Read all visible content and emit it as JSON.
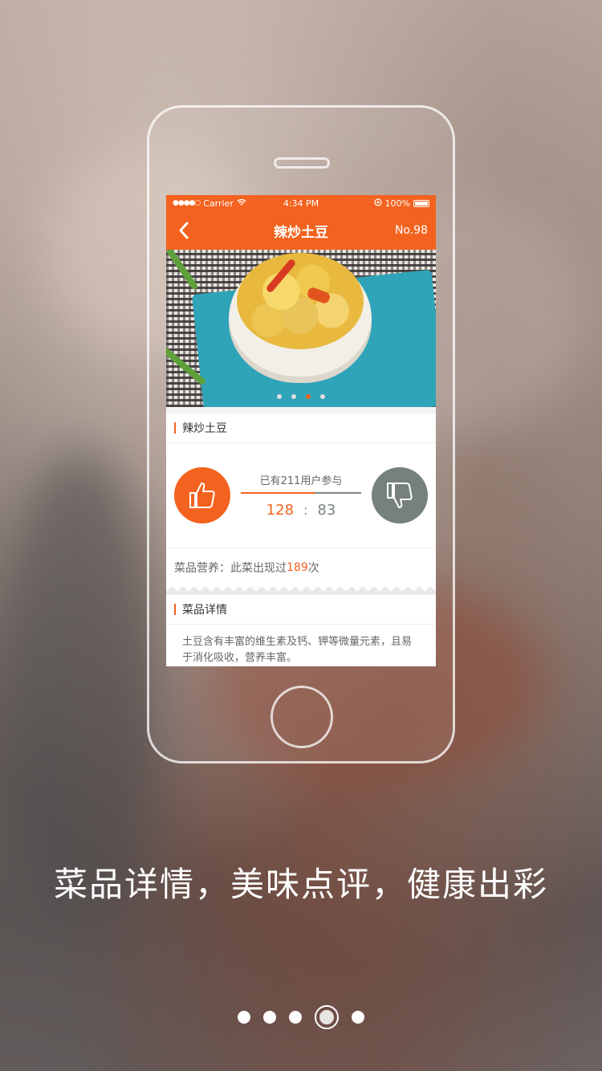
{
  "status_bar": {
    "carrier": "Carrier",
    "time": "4:34 PM",
    "battery": "100%"
  },
  "nav": {
    "title": "辣炒土豆",
    "number": "No.98"
  },
  "photo_pager": {
    "count": 4,
    "active_index": 2
  },
  "dish_section": {
    "title": "辣炒土豆"
  },
  "vote": {
    "participants": "已有211用户参与",
    "up_count": "128",
    "separator": ":",
    "down_count": "83",
    "up_share": 0.61
  },
  "nutrition": {
    "prefix": "菜品营养：此菜出现过",
    "count": "189",
    "suffix": "次"
  },
  "detail_section": {
    "title": "菜品详情",
    "text": "土豆含有丰富的维生素及钙、钾等微量元素，且易于消化吸收，营养丰富。"
  },
  "caption": "菜品详情，美味点评，健康出彩",
  "page_indicator": {
    "count": 5,
    "current_index": 3
  },
  "colors": {
    "accent": "#f3621e",
    "dislike": "#76807f"
  }
}
